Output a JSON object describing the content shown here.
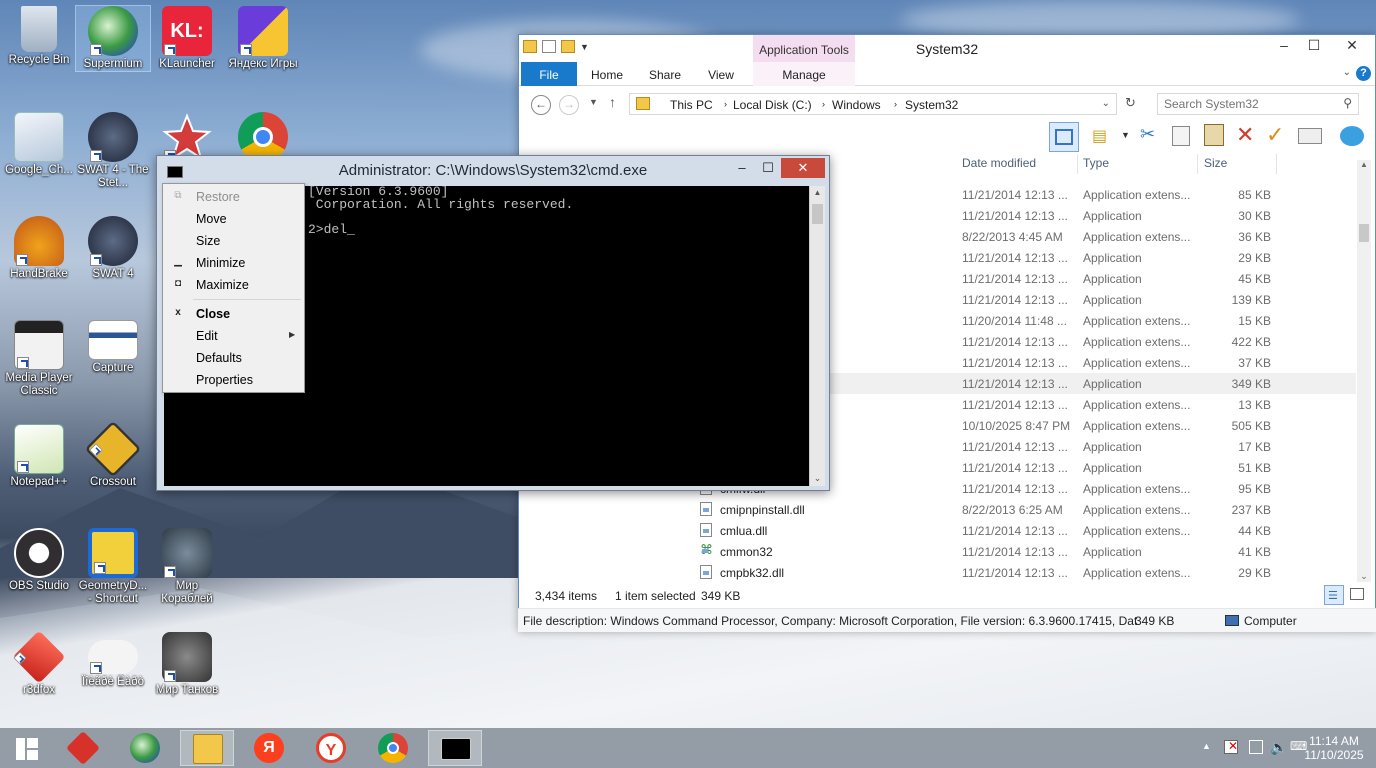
{
  "desktop": {
    "icons": [
      {
        "label": "Recycle Bin"
      },
      {
        "label": "Supermium"
      },
      {
        "label": "KLauncher"
      },
      {
        "label": "Яндекс Игры"
      },
      {
        "label": "Google_Ch..."
      },
      {
        "label": "SWAT 4 - The Stet..."
      },
      {
        "label": "HandBrake"
      },
      {
        "label": "SWAT 4"
      },
      {
        "label": "Media Player Classic"
      },
      {
        "label": "Capture"
      },
      {
        "label": "Notepad++"
      },
      {
        "label": "Crossout"
      },
      {
        "label": "OBS Studio"
      },
      {
        "label": "GeometryD... - Shortcut"
      },
      {
        "label": "Мир Кораблей"
      },
      {
        "label": "r3dfox"
      },
      {
        "label": "Ïîèãðè Êàðò"
      },
      {
        "label": "Мир Танков"
      }
    ],
    "klauncher_badge": "KL:"
  },
  "explorer": {
    "title": "System32",
    "context_tab_group": "Application Tools",
    "ribbon_tabs": {
      "file": "File",
      "home": "Home",
      "share": "Share",
      "view": "View",
      "manage": "Manage"
    },
    "breadcrumb": [
      "This PC",
      "Local Disk (C:)",
      "Windows",
      "System32"
    ],
    "search_placeholder": "Search System32",
    "columns": {
      "date": "Date modified",
      "type": "Type",
      "size": "Size"
    },
    "rows": [
      {
        "name": "",
        "date": "11/21/2014 12:13 ...",
        "type": "Application extens...",
        "size": "85 KB"
      },
      {
        "name": "",
        "date": "11/21/2014 12:13 ...",
        "type": "Application",
        "size": "30 KB"
      },
      {
        "name": "",
        "date": "8/22/2013 4:45 AM",
        "type": "Application extens...",
        "size": "36 KB"
      },
      {
        "name": "",
        "date": "11/21/2014 12:13 ...",
        "type": "Application",
        "size": "29 KB"
      },
      {
        "name": "",
        "date": "11/21/2014 12:13 ...",
        "type": "Application",
        "size": "45 KB"
      },
      {
        "name": "",
        "date": "11/21/2014 12:13 ...",
        "type": "Application",
        "size": "139 KB"
      },
      {
        "name": "",
        "date": "11/20/2014 11:48 ...",
        "type": "Application extens...",
        "size": "15 KB"
      },
      {
        "name": "",
        "date": "11/21/2014 12:13 ...",
        "type": "Application extens...",
        "size": "422 KB"
      },
      {
        "name": "",
        "date": "11/21/2014 12:13 ...",
        "type": "Application extens...",
        "size": "37 KB"
      },
      {
        "name": "",
        "date": "11/21/2014 12:13 ...",
        "type": "Application",
        "size": "349 KB"
      },
      {
        "name": "",
        "date": "11/21/2014 12:13 ...",
        "type": "Application extens...",
        "size": "13 KB"
      },
      {
        "name": "",
        "date": "10/10/2025 8:47 PM",
        "type": "Application extens...",
        "size": "505 KB"
      },
      {
        "name": "",
        "date": "11/21/2014 12:13 ...",
        "type": "Application",
        "size": "17 KB"
      },
      {
        "name": "",
        "date": "11/21/2014 12:13 ...",
        "type": "Application",
        "size": "51 KB"
      },
      {
        "name": "cmifw.dll",
        "date": "11/21/2014 12:13 ...",
        "type": "Application extens...",
        "size": "95 KB"
      },
      {
        "name": "cmipnpinstall.dll",
        "date": "8/22/2013 6:25 AM",
        "type": "Application extens...",
        "size": "237 KB"
      },
      {
        "name": "cmlua.dll",
        "date": "11/21/2014 12:13 ...",
        "type": "Application extens...",
        "size": "44 KB"
      },
      {
        "name": "cmmon32",
        "date": "11/21/2014 12:13 ...",
        "type": "Application",
        "size": "41 KB"
      },
      {
        "name": "cmpbk32.dll",
        "date": "11/21/2014 12:13 ...",
        "type": "Application extens...",
        "size": "29 KB"
      }
    ],
    "status": {
      "items": "3,434 items",
      "selected": "1 item selected",
      "sel_size": "349 KB"
    },
    "details": {
      "description": "File description: Windows Command Processor, Company: Microsoft Corporation, File version: 6.3.9600.17415, Dat",
      "size": "349 KB",
      "location": "Computer"
    }
  },
  "cmd": {
    "title": "Administrator: C:\\Windows\\System32\\cmd.exe",
    "lines": [
      "[Version 6.3.9600]",
      " Corporation. All rights reserved.",
      "",
      "2>del_"
    ]
  },
  "system_menu": {
    "restore": "Restore",
    "move": "Move",
    "size": "Size",
    "minimize": "Minimize",
    "maximize": "Maximize",
    "close": "Close",
    "edit": "Edit",
    "defaults": "Defaults",
    "properties": "Properties"
  },
  "taskbar": {
    "clock_time": "11:14 AM",
    "clock_date": "11/10/2025",
    "yandex_letter": "Я"
  }
}
